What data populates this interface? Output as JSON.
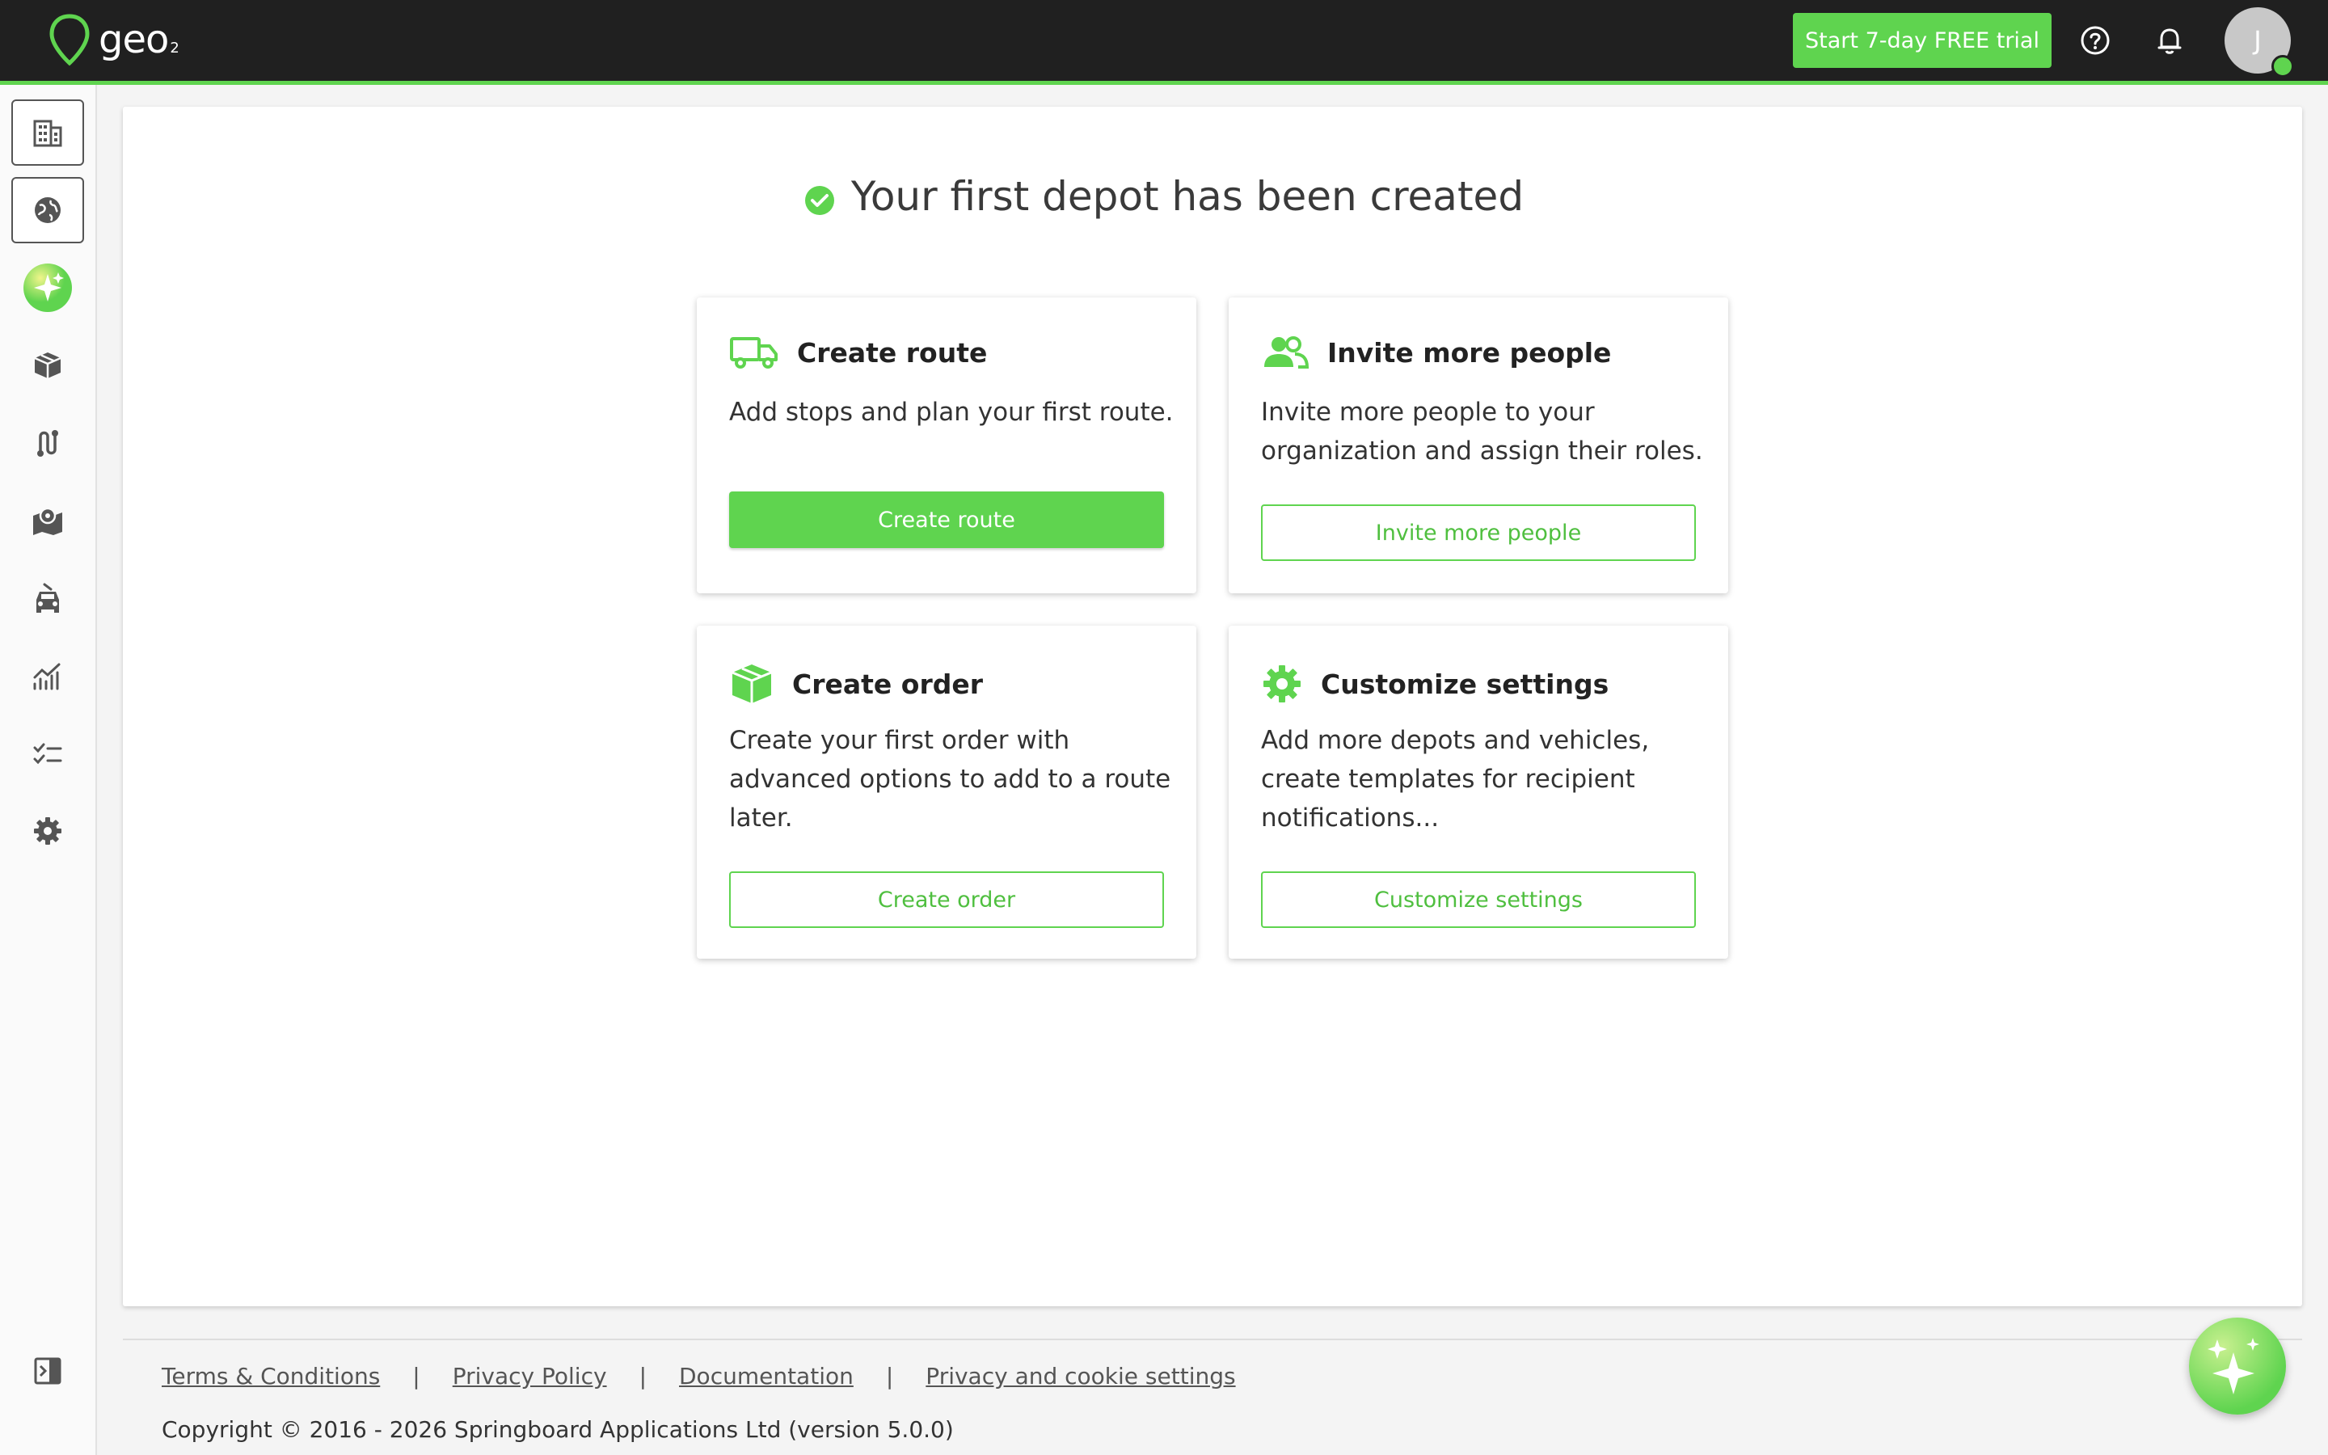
{
  "brand": {
    "name": "geo",
    "suffix": "2"
  },
  "header": {
    "trial_label": "Start 7-day FREE trial",
    "avatar_initial": "J"
  },
  "colors": {
    "accent": "#5fd44f",
    "topbar": "#202020"
  },
  "sidebar": {
    "items": [
      {
        "icon": "building-icon"
      },
      {
        "icon": "globe-icon"
      },
      {
        "icon": "ai-sparkle-icon"
      },
      {
        "icon": "package-icon"
      },
      {
        "icon": "route-icon"
      },
      {
        "icon": "map-pin-icon"
      },
      {
        "icon": "vehicle-icon"
      },
      {
        "icon": "analytics-icon"
      },
      {
        "icon": "checklist-icon"
      },
      {
        "icon": "settings-gear-icon"
      },
      {
        "icon": "collapse-sidebar-icon"
      }
    ]
  },
  "main": {
    "headline": "Your first depot has been created",
    "cards": [
      {
        "title": "Create route",
        "text": "Add stops and plan your first route.",
        "button": "Create route",
        "icon": "truck-icon"
      },
      {
        "title": "Invite more people",
        "text": "Invite more people to your organization and assign their roles.",
        "button": "Invite more people",
        "icon": "people-icon"
      },
      {
        "title": "Create order",
        "text": "Create your first order with advanced options to add to a route later.",
        "button": "Create order",
        "icon": "box-icon"
      },
      {
        "title": "Customize settings",
        "text": "Add more depots and vehicles, create templates for recipient notifications...",
        "button": "Customize settings",
        "icon": "gear-icon"
      }
    ]
  },
  "footer": {
    "links": [
      "Terms & Conditions",
      "Privacy Policy",
      "Documentation",
      "Privacy and cookie settings"
    ],
    "copyright": "Copyright © 2016 - 2026 Springboard Applications Ltd (version 5.0.0)"
  }
}
